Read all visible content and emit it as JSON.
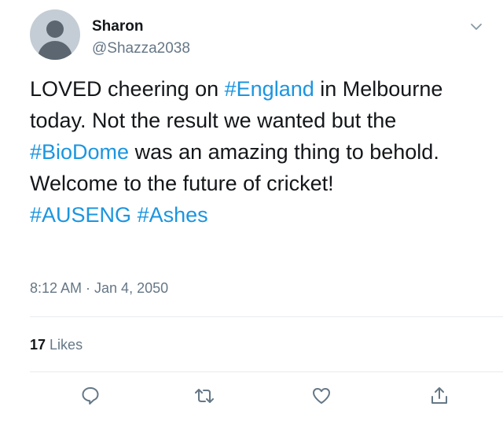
{
  "tweet": {
    "author": {
      "display_name": "Sharon",
      "handle": "@Shazza2038",
      "avatar_icon": "default-avatar-icon"
    },
    "menu_icon": "chevron-down-icon",
    "text_segments": [
      {
        "text": "LOVED cheering on ",
        "type": "text"
      },
      {
        "text": "#England",
        "type": "hashtag"
      },
      {
        "text": " in Melbourne today. Not the result we wanted but the ",
        "type": "text"
      },
      {
        "text": "#BioDome",
        "type": "hashtag"
      },
      {
        "text": " was an amazing thing to behold. Welcome to the future of cricket!",
        "type": "text"
      }
    ],
    "hashtag_line": [
      "#AUSENG",
      "#Ashes"
    ],
    "timestamp": "8:12 AM · Jan 4, 2050",
    "likes": {
      "count": "17",
      "label": "Likes"
    },
    "actions": [
      {
        "name": "reply",
        "icon": "reply-icon"
      },
      {
        "name": "retweet",
        "icon": "retweet-icon"
      },
      {
        "name": "like",
        "icon": "heart-icon"
      },
      {
        "name": "share",
        "icon": "share-icon"
      }
    ]
  },
  "colors": {
    "text": "#14171a",
    "secondary": "#657786",
    "link": "#1b95e0",
    "divider": "#e6ecf0",
    "icon": "#657786"
  }
}
